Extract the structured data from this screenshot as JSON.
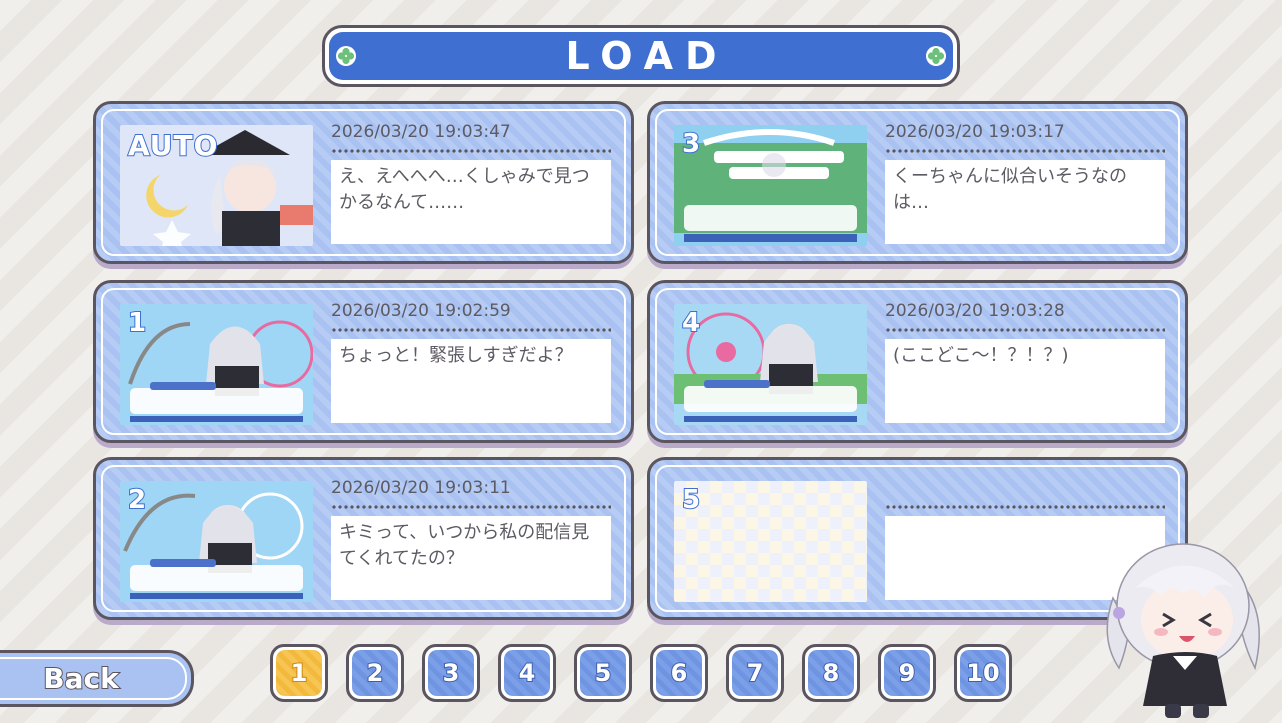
{
  "title": "LOAD",
  "back_label": "Back",
  "slots": [
    {
      "label": "AUTO",
      "date": "2026/03/20 19:03:47",
      "text": "え、えへへへ…くしゃみで見つかるなんて……"
    },
    {
      "label": "3",
      "date": "2026/03/20 19:03:17",
      "text": "くーちゃんに似合いそうなのは…"
    },
    {
      "label": "1",
      "date": "2026/03/20 19:02:59",
      "text": "ちょっと！緊張しすぎだよ？"
    },
    {
      "label": "4",
      "date": "2026/03/20 19:03:28",
      "text": "(ここどこ～！？！？)"
    },
    {
      "label": "2",
      "date": "2026/03/20 19:03:11",
      "text": "キミって、いつから私の配信見てくれてたの？"
    },
    {
      "label": "5",
      "date": "",
      "text": ""
    }
  ],
  "pages": [
    "1",
    "2",
    "3",
    "4",
    "5",
    "6",
    "7",
    "8",
    "9",
    "10"
  ],
  "active_page": "1",
  "colors": {
    "accent": "#3f6fd0",
    "card": "#a9c2f1",
    "active_page": "#f3b93a",
    "border": "#5b5560"
  }
}
